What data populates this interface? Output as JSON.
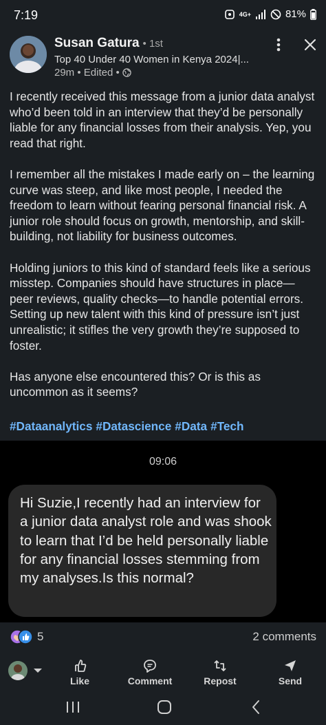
{
  "status_bar": {
    "time": "7:19",
    "network": "4G+",
    "battery": "81%"
  },
  "post": {
    "author": {
      "name": "Susan Gatura",
      "degree": "• 1st",
      "headline": "Top 40 Under 40 Women in Kenya 2024|...",
      "meta": "29m • Edited •"
    },
    "paragraphs": [
      "I recently received this message from a junior data analyst who’d been told in an interview that they’d be personally liable for any financial losses from their analysis. Yep, you read that right.",
      "I remember all the mistakes I made early on – the learning curve was steep, and like most people, I needed the freedom to learn without fearing personal financial risk. A junior role should focus on growth, mentorship, and skill-building, not liability for business outcomes.",
      "Holding juniors to this kind of standard feels like a serious misstep. Companies should have structures in place—peer reviews, quality checks—to handle potential errors. Setting up new talent with this kind of pressure isn’t just unrealistic; it stifles the very growth they’re supposed to foster.",
      "Has anyone else encountered this? Or is this as uncommon as it seems?"
    ],
    "hashtags": [
      "#Dataanalytics",
      "#Datascience",
      "#Data",
      "#Tech"
    ],
    "embedded_message": {
      "time": "09:06",
      "text": "Hi Suzie,I recently had an interview for a junior data analyst role and was shook to learn that I’d be held personally liable for any financial losses stemming from my analyses.Is this normal?"
    },
    "reactions_count": "5",
    "comments_count": "2 comments"
  },
  "actions": [
    {
      "label": "Like",
      "icon": "like-icon"
    },
    {
      "label": "Comment",
      "icon": "comment-icon"
    },
    {
      "label": "Repost",
      "icon": "repost-icon"
    },
    {
      "label": "Send",
      "icon": "send-icon"
    }
  ],
  "colors": {
    "background": "#1b1f23",
    "hashtag": "#71b7fb",
    "embed_background": "#000000",
    "bubble": "#282828"
  }
}
